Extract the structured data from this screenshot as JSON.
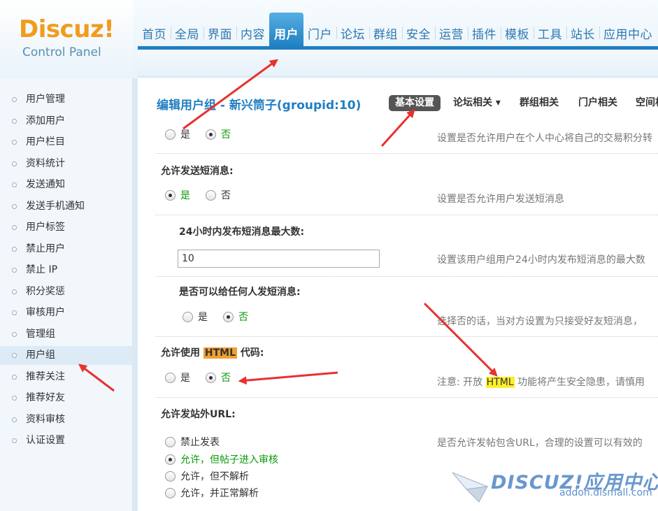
{
  "logo": {
    "main": "Discuz!",
    "sub": "Control Panel"
  },
  "nav": [
    {
      "label": "首页"
    },
    {
      "label": "全局"
    },
    {
      "label": "界面"
    },
    {
      "label": "内容"
    },
    {
      "label": "用户",
      "active": true
    },
    {
      "label": "门户"
    },
    {
      "label": "论坛"
    },
    {
      "label": "群组"
    },
    {
      "label": "安全"
    },
    {
      "label": "运营"
    },
    {
      "label": "插件"
    },
    {
      "label": "模板"
    },
    {
      "label": "工具"
    },
    {
      "label": "站长"
    },
    {
      "label": "应用中心"
    }
  ],
  "sidebar": [
    {
      "label": "用户管理"
    },
    {
      "label": "添加用户"
    },
    {
      "label": "用户栏目"
    },
    {
      "label": "资料统计"
    },
    {
      "label": "发送通知"
    },
    {
      "label": "发送手机通知"
    },
    {
      "label": "用户标签"
    },
    {
      "label": "禁止用户"
    },
    {
      "label": "禁止 IP"
    },
    {
      "label": "积分奖惩"
    },
    {
      "label": "审核用户"
    },
    {
      "label": "管理组"
    },
    {
      "label": "用户组",
      "active": true
    },
    {
      "label": "推荐关注"
    },
    {
      "label": "推荐好友"
    },
    {
      "label": "资料审核"
    },
    {
      "label": "认证设置"
    }
  ],
  "main": {
    "title": "编辑用户组 - 新兴筒子(groupid:10)",
    "tabs": {
      "basic": "基本设置",
      "forum": "论坛相关 ▾",
      "group": "群组相关",
      "portal": "门户相关",
      "space": "空间相关"
    },
    "row1": {
      "yes": "是",
      "no": "否",
      "desc": "设置是否允许用户在个人中心将自己的交易积分转"
    },
    "sms": {
      "label": "允许发送短消息:",
      "yes": "是",
      "no": "否",
      "desc": "设置是否允许用户发送短消息"
    },
    "sms_limit": {
      "label": "24小时内发布短消息最大数:",
      "value": "10",
      "desc": "设置该用户组用户24小时内发布短消息的最大数"
    },
    "sms_anyone": {
      "label": "是否可以给任何人发短消息:",
      "yes": "是",
      "no": "否",
      "desc": "选择否的话，当对方设置为只接受好友短消息，"
    },
    "html": {
      "label_pre": "允许使用 ",
      "label_hl": "HTML",
      "label_post": " 代码:",
      "yes": "是",
      "no": "否",
      "desc_pre": "注意: 开放 ",
      "desc_hl": "HTML",
      "desc_post": " 功能将产生安全隐患，请慎用"
    },
    "url": {
      "label": "允许发站外URL:",
      "opt1": "禁止发表",
      "opt2": "允许，但帖子进入审核",
      "opt3": "允许，但不解析",
      "opt4": "允许，并正常解析",
      "desc": "是否允许发帖包含URL，合理的设置可以有效的"
    }
  },
  "watermark": {
    "brand": "DISCUZ!应用中心",
    "url": "addon.dismall.com"
  },
  "colors": {
    "accent": "#1f7fc1",
    "logo": "#f29b1d",
    "arrow": "#e8312f",
    "checked_text": "#0b9a0b"
  }
}
